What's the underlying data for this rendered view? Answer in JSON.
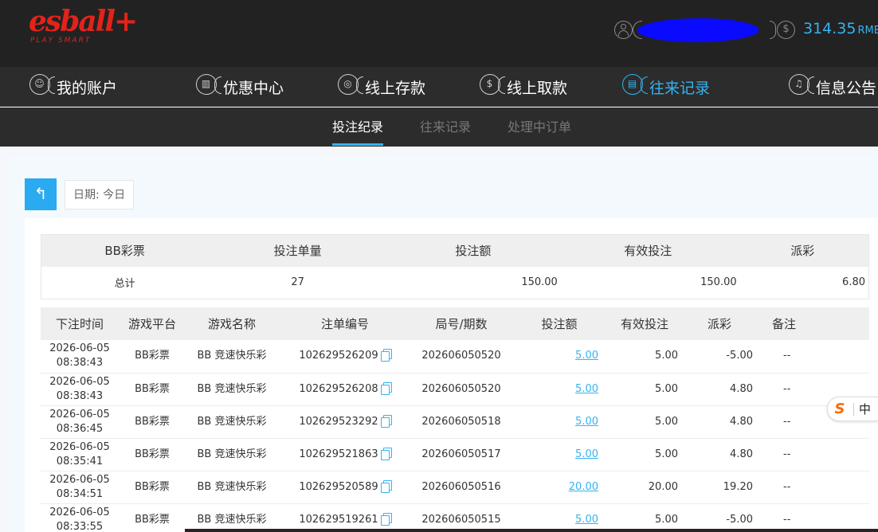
{
  "header": {
    "logo_text": "esball+",
    "logo_tagline": "PLAY SMART",
    "balance": "314.35",
    "currency": "RMB"
  },
  "nav": {
    "items": [
      {
        "label": "我的账户",
        "icon": "user-icon",
        "active": false
      },
      {
        "label": "优惠中心",
        "icon": "gift-icon",
        "active": false
      },
      {
        "label": "线上存款",
        "icon": "deposit-icon",
        "active": false
      },
      {
        "label": "线上取款",
        "icon": "withdraw-icon",
        "active": false
      },
      {
        "label": "往来记录",
        "icon": "record-icon",
        "active": true
      },
      {
        "label": "信息公告",
        "icon": "bell-icon",
        "active": false
      }
    ]
  },
  "subnav": {
    "tabs": [
      {
        "label": "投注纪录",
        "active": true
      },
      {
        "label": "往来记录",
        "active": false
      },
      {
        "label": "处理中订单",
        "active": false
      }
    ]
  },
  "filter": {
    "date_label": "日期: 今日"
  },
  "summary": {
    "headers": [
      "BB彩票",
      "投注单量",
      "投注额",
      "有效投注",
      "派彩"
    ],
    "row": [
      "总计",
      "27",
      "150.00",
      "150.00",
      "6.80"
    ]
  },
  "records": {
    "headers": [
      "下注时间",
      "游戏平台",
      "游戏名称",
      "注单编号",
      "局号/期数",
      "投注额",
      "有效投注",
      "派彩",
      "备注"
    ],
    "rows": [
      {
        "date": "2026-06-05",
        "time": "08:38:43",
        "platform": "BB彩票",
        "game": "BB 竞速快乐彩",
        "order_no": "102629526209",
        "period": "202606050520",
        "bet": "5.00",
        "valid": "5.00",
        "payout": "-5.00",
        "note": "--"
      },
      {
        "date": "2026-06-05",
        "time": "08:38:43",
        "platform": "BB彩票",
        "game": "BB 竞速快乐彩",
        "order_no": "102629526208",
        "period": "202606050520",
        "bet": "5.00",
        "valid": "5.00",
        "payout": "4.80",
        "note": "--"
      },
      {
        "date": "2026-06-05",
        "time": "08:36:45",
        "platform": "BB彩票",
        "game": "BB 竞速快乐彩",
        "order_no": "102629523292",
        "period": "202606050518",
        "bet": "5.00",
        "valid": "5.00",
        "payout": "4.80",
        "note": "--"
      },
      {
        "date": "2026-06-05",
        "time": "08:35:41",
        "platform": "BB彩票",
        "game": "BB 竞速快乐彩",
        "order_no": "102629521863",
        "period": "202606050517",
        "bet": "5.00",
        "valid": "5.00",
        "payout": "4.80",
        "note": "--"
      },
      {
        "date": "2026-06-05",
        "time": "08:34:51",
        "platform": "BB彩票",
        "game": "BB 竞速快乐彩",
        "order_no": "102629520589",
        "period": "202606050516",
        "bet": "20.00",
        "valid": "20.00",
        "payout": "19.20",
        "note": "--"
      },
      {
        "date": "2026-06-05",
        "time": "08:33:55",
        "platform": "BB彩票",
        "game": "BB 竞速快乐彩",
        "order_no": "102629519261",
        "period": "202606050515",
        "bet": "5.00",
        "valid": "5.00",
        "payout": "-5.00",
        "note": "--"
      }
    ]
  },
  "ime": {
    "logo": "S",
    "mode": "中"
  },
  "colors": {
    "accent": "#36b3f0",
    "negative": "#e24a5f",
    "header_bg": "#222222",
    "logo_red": "#e2231a"
  }
}
